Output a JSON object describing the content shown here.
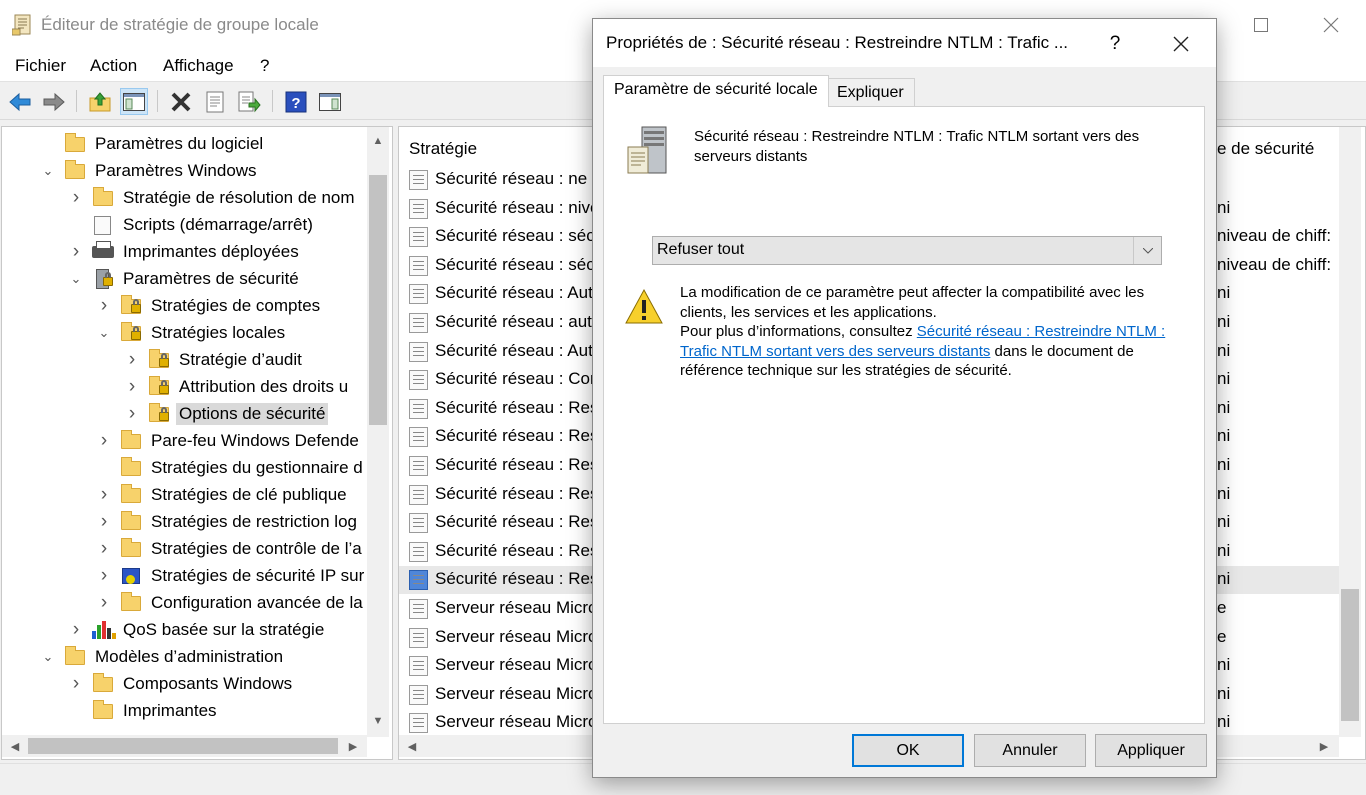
{
  "window": {
    "title": "Éditeur de stratégie de groupe locale"
  },
  "menu": {
    "items": [
      "Fichier",
      "Action",
      "Affichage",
      "?"
    ]
  },
  "toolbar": {
    "icons": [
      "back-arrow-icon",
      "forward-arrow-icon",
      "up-folder-icon",
      "show-hide-tree-icon",
      "delete-icon",
      "properties-icon",
      "export-list-icon",
      "help-icon",
      "show-action-pane-icon"
    ]
  },
  "tree": {
    "items": [
      {
        "label": "Paramètres du logiciel",
        "depth": 1,
        "expander": "",
        "icon": "folder"
      },
      {
        "label": "Paramètres Windows",
        "depth": 1,
        "expander": "open",
        "icon": "folder"
      },
      {
        "label": "Stratégie de résolution de nom",
        "depth": 2,
        "expander": "closed",
        "icon": "folder"
      },
      {
        "label": "Scripts (démarrage/arrêt)",
        "depth": 2,
        "expander": "",
        "icon": "scripts"
      },
      {
        "label": "Imprimantes déployées",
        "depth": 2,
        "expander": "closed",
        "icon": "printer"
      },
      {
        "label": "Paramètres de sécurité",
        "depth": 2,
        "expander": "open",
        "icon": "security"
      },
      {
        "label": "Stratégies de comptes",
        "depth": 3,
        "expander": "closed",
        "icon": "lockfolder"
      },
      {
        "label": "Stratégies locales",
        "depth": 3,
        "expander": "open",
        "icon": "lockfolder"
      },
      {
        "label": "Stratégie d’audit",
        "depth": 4,
        "expander": "closed",
        "icon": "lockfolder"
      },
      {
        "label": "Attribution des droits u",
        "depth": 4,
        "expander": "closed",
        "icon": "lockfolder"
      },
      {
        "label": "Options de sécurité",
        "depth": 4,
        "expander": "closed",
        "icon": "lockfolder",
        "selected": true
      },
      {
        "label": "Pare-feu Windows Defende",
        "depth": 3,
        "expander": "closed",
        "icon": "folder"
      },
      {
        "label": "Stratégies du gestionnaire d",
        "depth": 3,
        "expander": "",
        "icon": "folder"
      },
      {
        "label": "Stratégies de clé publique",
        "depth": 3,
        "expander": "closed",
        "icon": "folder"
      },
      {
        "label": "Stratégies de restriction log",
        "depth": 3,
        "expander": "closed",
        "icon": "folder"
      },
      {
        "label": "Stratégies de contrôle de l’a",
        "depth": 3,
        "expander": "closed",
        "icon": "folder"
      },
      {
        "label": "Stratégies de sécurité IP sur",
        "depth": 3,
        "expander": "closed",
        "icon": "ipsec"
      },
      {
        "label": "Configuration avancée de la",
        "depth": 3,
        "expander": "closed",
        "icon": "folder"
      },
      {
        "label": "QoS basée sur la stratégie",
        "depth": 2,
        "expander": "closed",
        "icon": "qos"
      },
      {
        "label": "Modèles d’administration",
        "depth": 1,
        "expander": "open",
        "icon": "folder"
      },
      {
        "label": "Composants Windows",
        "depth": 2,
        "expander": "closed",
        "icon": "folder"
      },
      {
        "label": "Imprimantes",
        "depth": 2,
        "expander": "",
        "icon": "folder"
      }
    ]
  },
  "list": {
    "column_strategie": "Stratégie",
    "column_parametre": "e de sécurité",
    "rows": [
      {
        "name": "Sécurité réseau : ne p",
        "right": ""
      },
      {
        "name": "Sécurité réseau : nive",
        "right": "ni"
      },
      {
        "name": "Sécurité réseau : sécu",
        "right": "niveau de chiff:"
      },
      {
        "name": "Sécurité réseau : sécu",
        "right": "niveau de chiff:"
      },
      {
        "name": "Sécurité réseau : Auto",
        "right": "ni"
      },
      {
        "name": "Sécurité réseau : auto",
        "right": "ni"
      },
      {
        "name": "Sécurité réseau : Auto",
        "right": "ni"
      },
      {
        "name": "Sécurité réseau : Con",
        "right": "ni"
      },
      {
        "name": "Sécurité réseau : Rest",
        "right": "ni"
      },
      {
        "name": "Sécurité réseau : Rest",
        "right": "ni"
      },
      {
        "name": "Sécurité réseau : Rest",
        "right": "ni"
      },
      {
        "name": "Sécurité réseau : Rest",
        "right": "ni"
      },
      {
        "name": "Sécurité réseau : Rest",
        "right": "ni"
      },
      {
        "name": "Sécurité réseau : Rest",
        "right": "ni"
      },
      {
        "name": "Sécurité réseau : Rest",
        "right": "ni",
        "highlight": true
      },
      {
        "name": "Serveur réseau Micro",
        "right": "e"
      },
      {
        "name": "Serveur réseau Micro",
        "right": "e"
      },
      {
        "name": "Serveur réseau Micro",
        "right": "ni"
      },
      {
        "name": "Serveur réseau Micro",
        "right": "ni"
      },
      {
        "name": "Serveur réseau Micro",
        "right": "ni"
      }
    ]
  },
  "dialog": {
    "title": "Propriétés de : Sécurité réseau : Restreindre NTLM : Trafic ...",
    "help": "?",
    "tabs": [
      "Paramètre de sécurité locale",
      "Expliquer"
    ],
    "policy_name": "Sécurité réseau : Restreindre NTLM : Trafic NTLM sortant vers des serveurs distants",
    "dropdown_value": "Refuser tout",
    "warning_text_1": "La modification de ce paramètre peut affecter la compatibilité avec les clients, les services et les applications.",
    "warning_text_2": "Pour plus d’informations, consultez ",
    "warning_link": "Sécurité réseau : Restreindre NTLM : Trafic NTLM sortant vers des serveurs distants",
    "warning_text_3": " dans le document de référence technique sur les stratégies de sécurité.",
    "buttons": {
      "ok": "OK",
      "cancel": "Annuler",
      "apply": "Appliquer"
    }
  },
  "colors": {
    "accent": "#0078d7",
    "link": "#0066cc",
    "selection": "#d9d9d9",
    "folder": "#f7d26b"
  }
}
